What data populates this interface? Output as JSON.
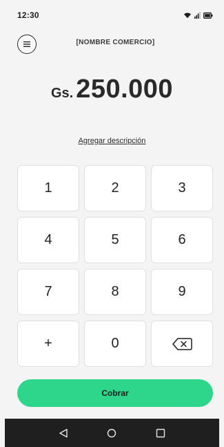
{
  "status_bar": {
    "time": "12:30",
    "icons": [
      "wifi-icon",
      "signal-icon",
      "battery-icon"
    ]
  },
  "header": {
    "menu_icon": "hamburger-menu-icon",
    "merchant_name": "[NOMBRE COMERCIO]"
  },
  "amount": {
    "currency": "Gs.",
    "value": "250.000"
  },
  "description_link": "Agregar descripción",
  "keypad": {
    "keys": [
      "1",
      "2",
      "3",
      "4",
      "5",
      "6",
      "7",
      "8",
      "9",
      "+",
      "0"
    ],
    "backspace_icon": "backspace-icon"
  },
  "charge_button": "Cobrar",
  "nav_bar": {
    "icons": [
      "back-triangle-icon",
      "home-circle-icon",
      "recents-square-icon"
    ]
  },
  "colors": {
    "accent": "#2dd68a",
    "background": "#f4f4f4",
    "nav_bar": "#1f1f1f"
  }
}
